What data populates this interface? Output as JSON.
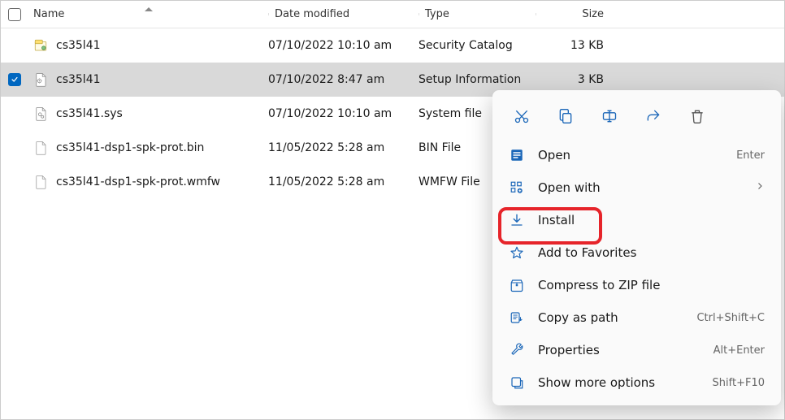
{
  "columns": {
    "name": "Name",
    "date": "Date modified",
    "type": "Type",
    "size": "Size"
  },
  "files": [
    {
      "name": "cs35l41",
      "date": "07/10/2022 10:10 am",
      "type": "Security Catalog",
      "size": "13 KB"
    },
    {
      "name": "cs35l41",
      "date": "07/10/2022 8:47 am",
      "type": "Setup Information",
      "size": "3 KB"
    },
    {
      "name": "cs35l41.sys",
      "date": "07/10/2022 10:10 am",
      "type": "System file",
      "size": ""
    },
    {
      "name": "cs35l41-dsp1-spk-prot.bin",
      "date": "11/05/2022 5:28 am",
      "type": "BIN File",
      "size": ""
    },
    {
      "name": "cs35l41-dsp1-spk-prot.wmfw",
      "date": "11/05/2022 5:28 am",
      "type": "WMFW File",
      "size": ""
    }
  ],
  "menu": {
    "open": "Open",
    "open_accel": "Enter",
    "openwith": "Open with",
    "install": "Install",
    "favorites": "Add to Favorites",
    "zip": "Compress to ZIP file",
    "copypath": "Copy as path",
    "copypath_accel": "Ctrl+Shift+C",
    "properties": "Properties",
    "properties_accel": "Alt+Enter",
    "more": "Show more options",
    "more_accel": "Shift+F10"
  }
}
